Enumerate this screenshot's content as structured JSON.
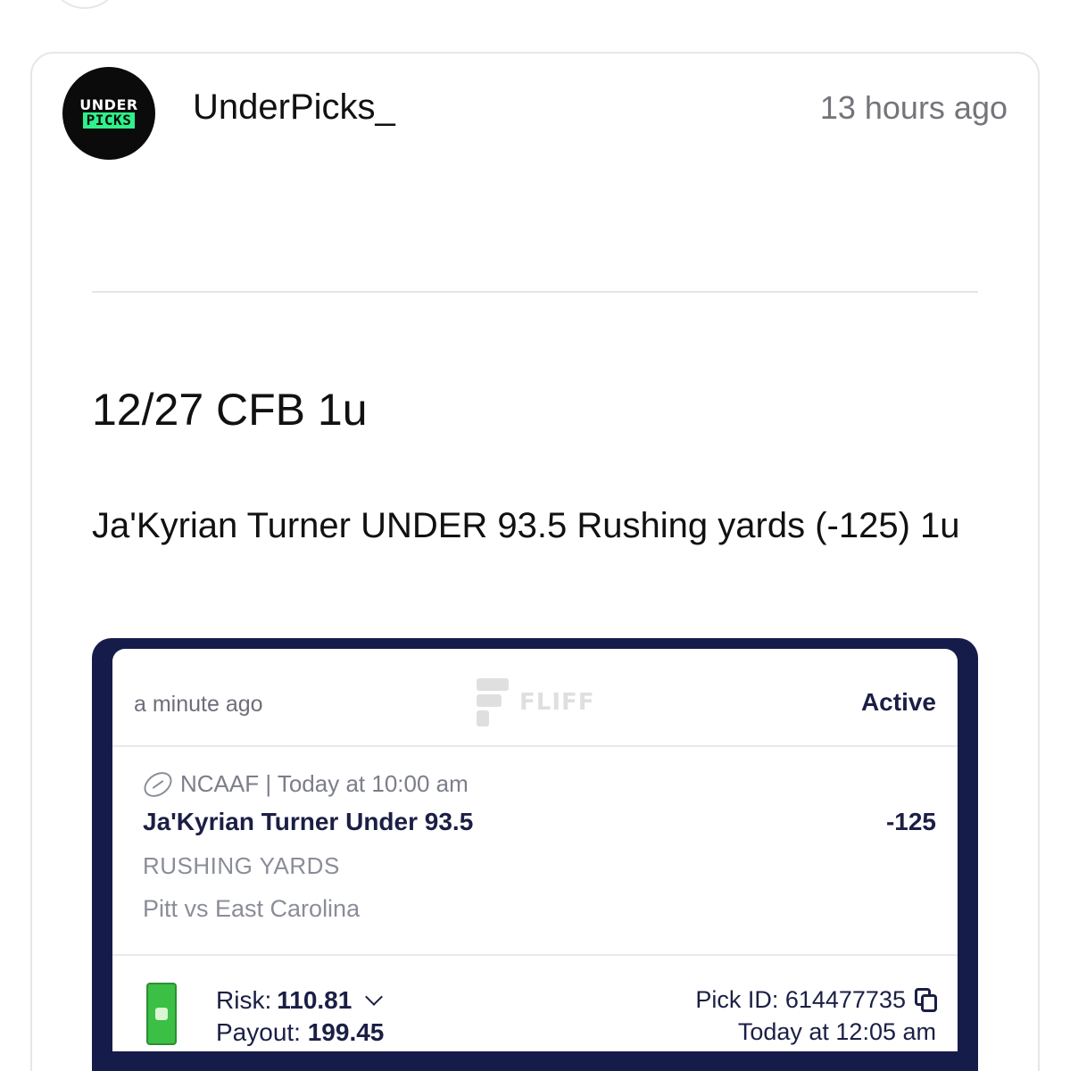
{
  "post": {
    "avatar": {
      "line1": "UNDER",
      "line2": "PICKS"
    },
    "username": "UnderPicks_",
    "timestamp": "13 hours ago",
    "title": "12/27 CFB 1u",
    "body": "Ja'Kyrian Turner UNDER 93.5 Rushing yards (-125) 1u"
  },
  "bet_slip": {
    "time": "a minute ago",
    "brand": "FLIFF",
    "status": "Active",
    "league_line": "NCAAF | Today at 10:00 am",
    "pick": "Ja'Kyrian Turner Under 93.5",
    "odds": "-125",
    "market": "RUSHING YARDS",
    "matchup": "Pitt vs East Carolina",
    "risk_label": "Risk:",
    "risk_value": "110.81",
    "payout_label": "Payout:",
    "payout_value": "199.45",
    "pick_id_text": "Pick ID: 614477735",
    "placed_at": "Today at 12:05 am"
  },
  "colors": {
    "slip_frame": "#161c4a",
    "slip_text": "#1b1f45",
    "avatar_accent": "#2ff08a",
    "cash_green": "#3bbf45"
  },
  "icons": [
    "football-icon",
    "chevron-down-icon",
    "copy-icon",
    "cash-icon",
    "fliff-logo"
  ]
}
